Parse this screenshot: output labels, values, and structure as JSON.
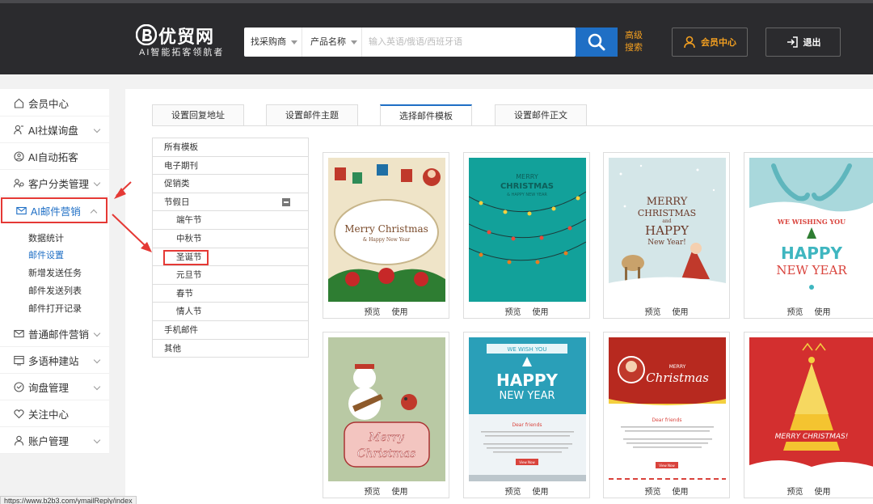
{
  "header": {
    "logo_name": "优贸网",
    "logo_slogan": "AI智能拓客领航者",
    "search": {
      "type_select": "找采购商",
      "field_select": "产品名称",
      "placeholder": "输入英语/俄语/西班牙语"
    },
    "advanced_search": "高级搜索",
    "member_center": "会员中心",
    "logout": "退出"
  },
  "sidebar": {
    "items": [
      {
        "label": "会员中心",
        "icon": "home-icon"
      },
      {
        "label": "AI社媒询盘",
        "icon": "user-icon"
      },
      {
        "label": "AI自动拓客",
        "icon": "robot-icon"
      },
      {
        "label": "客户分类管理",
        "icon": "users-icon"
      },
      {
        "label": "AI邮件营销",
        "icon": "mail-icon"
      },
      {
        "label": "普通邮件营销",
        "icon": "mail-icon"
      },
      {
        "label": "多语种建站",
        "icon": "site-icon"
      },
      {
        "label": "询盘管理",
        "icon": "inquiry-icon"
      },
      {
        "label": "关注中心",
        "icon": "heart-icon"
      },
      {
        "label": "账户管理",
        "icon": "account-icon"
      }
    ],
    "sub_items": [
      "数据统计",
      "邮件设置",
      "新增发送任务",
      "邮件发送列表",
      "邮件打开记录"
    ]
  },
  "tabs": [
    "设置回复地址",
    "设置邮件主题",
    "选择邮件模板",
    "设置邮件正文"
  ],
  "categories": [
    "所有模板",
    "电子期刊",
    "促销类",
    "节假日",
    "端午节",
    "中秋节",
    "圣诞节",
    "元旦节",
    "春节",
    "情人节",
    "手机邮件",
    "其他"
  ],
  "templates": {
    "preview_label": "预览",
    "use_label": "使用",
    "items": [
      {
        "lines": [
          "Merry Christmas",
          "& Happy New Year"
        ]
      },
      {
        "lines": [
          "MERRY",
          "CHRISTMAS",
          "& HAPPY NEW YEAR"
        ]
      },
      {
        "lines": [
          "MERRY",
          "CHRISTMAS",
          "and",
          "HAPPY",
          "New Year!"
        ]
      },
      {
        "lines": [
          "WE WISHING YOU",
          "HAPPY",
          "NEW YEAR"
        ]
      },
      {
        "lines": [
          "Merry",
          "Christmas"
        ]
      },
      {
        "lines": [
          "WE WISH YOU",
          "HAPPY",
          "NEW YEAR",
          "Dear friends",
          "View Now"
        ]
      },
      {
        "lines": [
          "MERRY",
          "Christmas",
          "Dear friends",
          "View Now"
        ]
      },
      {
        "lines": [
          "MERRY CHRISTMAS!"
        ]
      }
    ]
  },
  "status_url": "https://www.b2b3.com/ymailReply/index"
}
